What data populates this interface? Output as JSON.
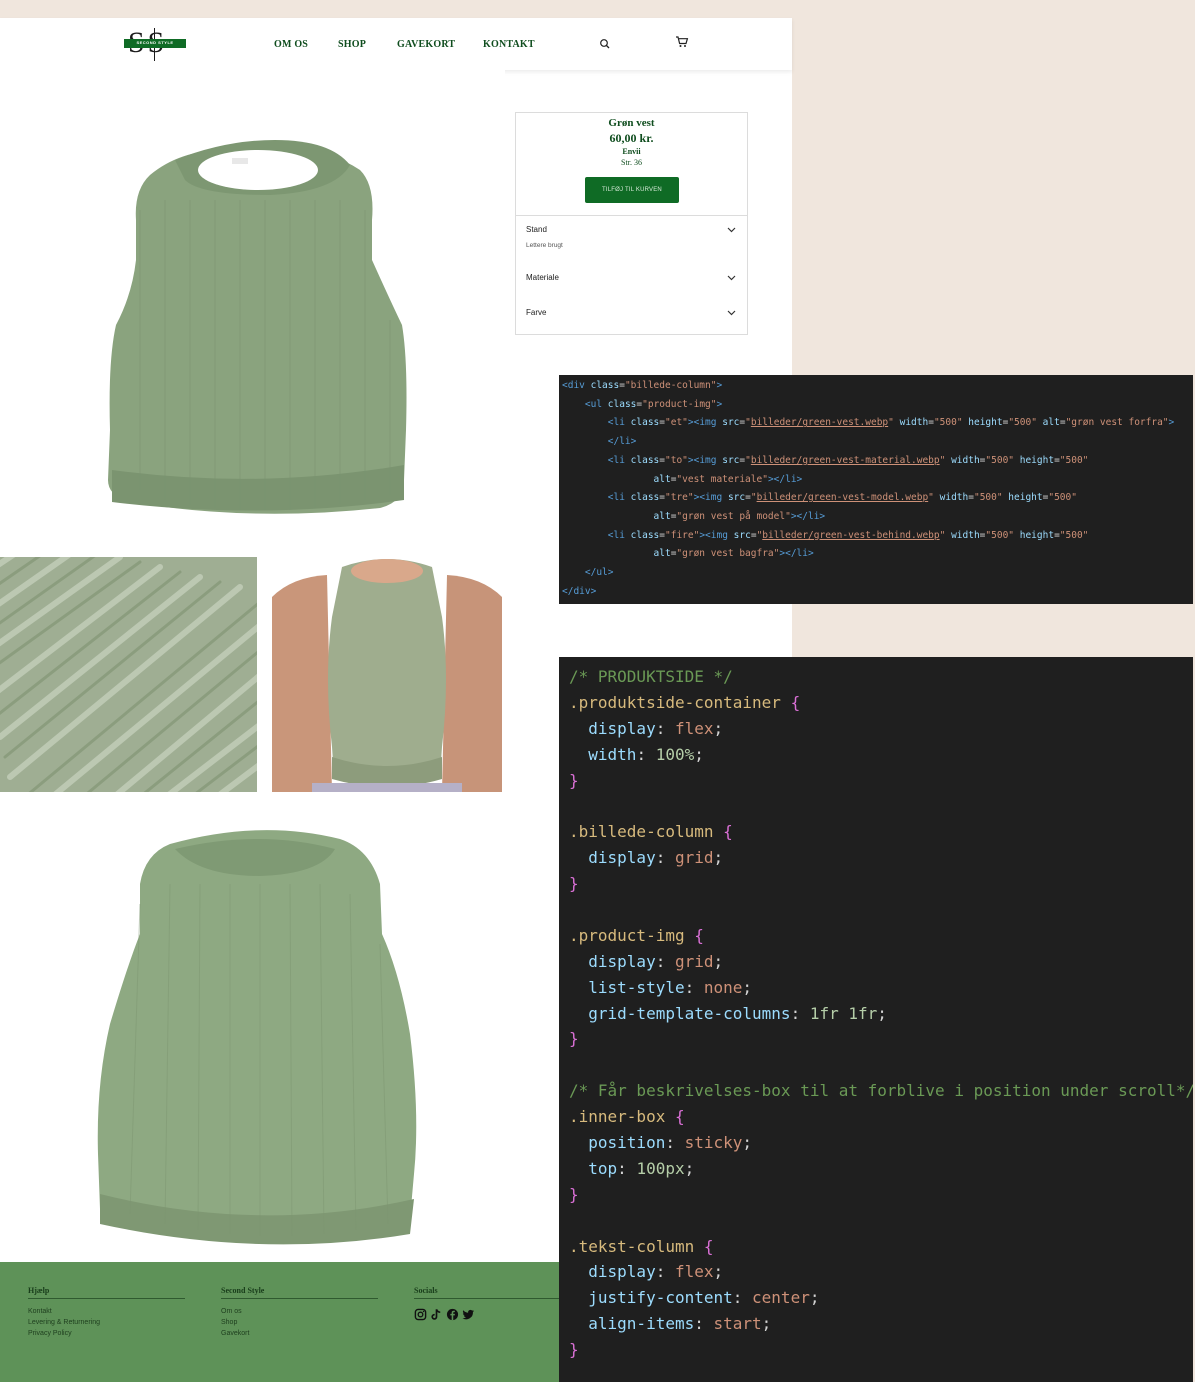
{
  "site": {
    "logo": {
      "monogram": "SS",
      "wordmark": "SECOND STYLE"
    },
    "nav": [
      "OM OS",
      "SHOP",
      "GAVEKORT",
      "KONTAKT"
    ],
    "icons": {
      "search": "search-icon",
      "cart": "cart-icon"
    },
    "product": {
      "title": "Grøn vest",
      "price": "60,00 kr.",
      "brand": "Envii",
      "size": "Str. 36",
      "add_to_cart": "TILFØJ TIL KURVEN",
      "accordions": [
        {
          "label": "Stand",
          "value": "Lettere brugt"
        },
        {
          "label": "Materiale",
          "value": ""
        },
        {
          "label": "Farve",
          "value": ""
        }
      ]
    },
    "footer": {
      "columns": [
        {
          "heading": "Hjælp",
          "links": [
            "Kontakt",
            "Levering & Returnering",
            "Privacy Policy"
          ]
        },
        {
          "heading": "Second Style",
          "links": [
            "Om os",
            "Shop",
            "Gavekort"
          ]
        },
        {
          "heading": "Socials",
          "icons": [
            "instagram-icon",
            "tiktok-icon",
            "facebook-icon",
            "twitter-icon"
          ]
        }
      ]
    },
    "colors": {
      "brand_green": "#0f6b25",
      "footer_green": "#5e9258",
      "background": "#f0e6dd"
    }
  },
  "html_code": [
    [
      [
        "tag",
        "<div "
      ],
      [
        "attr",
        "class"
      ],
      [
        "punct",
        "="
      ],
      [
        "str",
        "\"billede-column\""
      ],
      [
        "tag",
        ">"
      ]
    ],
    [
      [
        "punct",
        "    "
      ],
      [
        "tag",
        "<ul "
      ],
      [
        "attr",
        "class"
      ],
      [
        "punct",
        "="
      ],
      [
        "str",
        "\"product-img\""
      ],
      [
        "tag",
        ">"
      ]
    ],
    [
      [
        "punct",
        "        "
      ],
      [
        "tag",
        "<li "
      ],
      [
        "attr",
        "class"
      ],
      [
        "punct",
        "="
      ],
      [
        "str",
        "\"et\""
      ],
      [
        "tag",
        "><img "
      ],
      [
        "attr",
        "src"
      ],
      [
        "punct",
        "="
      ],
      [
        "str",
        "\""
      ],
      [
        "strlink",
        "billeder/green-vest.webp"
      ],
      [
        "str",
        "\""
      ],
      [
        "attr",
        " width"
      ],
      [
        "punct",
        "="
      ],
      [
        "str",
        "\"500\""
      ],
      [
        "attr",
        " height"
      ],
      [
        "punct",
        "="
      ],
      [
        "str",
        "\"500\""
      ],
      [
        "attr",
        " alt"
      ],
      [
        "punct",
        "="
      ],
      [
        "str",
        "\"grøn vest forfra\""
      ],
      [
        "tag",
        ">"
      ]
    ],
    [
      [
        "punct",
        "        "
      ],
      [
        "tag",
        "</li>"
      ]
    ],
    [
      [
        "punct",
        "        "
      ],
      [
        "tag",
        "<li "
      ],
      [
        "attr",
        "class"
      ],
      [
        "punct",
        "="
      ],
      [
        "str",
        "\"to\""
      ],
      [
        "tag",
        "><img "
      ],
      [
        "attr",
        "src"
      ],
      [
        "punct",
        "="
      ],
      [
        "str",
        "\""
      ],
      [
        "strlink",
        "billeder/green-vest-material.webp"
      ],
      [
        "str",
        "\""
      ],
      [
        "attr",
        " width"
      ],
      [
        "punct",
        "="
      ],
      [
        "str",
        "\"500\""
      ],
      [
        "attr",
        " height"
      ],
      [
        "punct",
        "="
      ],
      [
        "str",
        "\"500\""
      ]
    ],
    [
      [
        "punct",
        "                "
      ],
      [
        "attr",
        "alt"
      ],
      [
        "punct",
        "="
      ],
      [
        "str",
        "\"vest materiale\""
      ],
      [
        "tag",
        "></li>"
      ]
    ],
    [
      [
        "punct",
        "        "
      ],
      [
        "tag",
        "<li "
      ],
      [
        "attr",
        "class"
      ],
      [
        "punct",
        "="
      ],
      [
        "str",
        "\"tre\""
      ],
      [
        "tag",
        "><img "
      ],
      [
        "attr",
        "src"
      ],
      [
        "punct",
        "="
      ],
      [
        "str",
        "\""
      ],
      [
        "strlink",
        "billeder/green-vest-model.webp"
      ],
      [
        "str",
        "\""
      ],
      [
        "attr",
        " width"
      ],
      [
        "punct",
        "="
      ],
      [
        "str",
        "\"500\""
      ],
      [
        "attr",
        " height"
      ],
      [
        "punct",
        "="
      ],
      [
        "str",
        "\"500\""
      ]
    ],
    [
      [
        "punct",
        "                "
      ],
      [
        "attr",
        "alt"
      ],
      [
        "punct",
        "="
      ],
      [
        "str",
        "\"grøn vest på model\""
      ],
      [
        "tag",
        "></li>"
      ]
    ],
    [
      [
        "punct",
        "        "
      ],
      [
        "tag",
        "<li "
      ],
      [
        "attr",
        "class"
      ],
      [
        "punct",
        "="
      ],
      [
        "str",
        "\"fire\""
      ],
      [
        "tag",
        "><img "
      ],
      [
        "attr",
        "src"
      ],
      [
        "punct",
        "="
      ],
      [
        "str",
        "\""
      ],
      [
        "strlink",
        "billeder/green-vest-behind.webp"
      ],
      [
        "str",
        "\""
      ],
      [
        "attr",
        " width"
      ],
      [
        "punct",
        "="
      ],
      [
        "str",
        "\"500\""
      ],
      [
        "attr",
        " height"
      ],
      [
        "punct",
        "="
      ],
      [
        "str",
        "\"500\""
      ]
    ],
    [
      [
        "punct",
        "                "
      ],
      [
        "attr",
        "alt"
      ],
      [
        "punct",
        "="
      ],
      [
        "str",
        "\"grøn vest bagfra\""
      ],
      [
        "tag",
        "></li>"
      ]
    ],
    [
      [
        "punct",
        "    "
      ],
      [
        "tag",
        "</ul>"
      ]
    ],
    [
      [
        "tag",
        "</div>"
      ]
    ]
  ],
  "css_code": [
    [
      [
        "cmt",
        "/* PRODUKTSIDE */"
      ]
    ],
    [
      [
        "sel",
        ".produktside-container "
      ],
      [
        "brace",
        "{"
      ]
    ],
    [
      [
        "punct",
        "  "
      ],
      [
        "prop",
        "display"
      ],
      [
        "punct",
        ": "
      ],
      [
        "val",
        "flex"
      ],
      [
        "punct",
        ";"
      ]
    ],
    [
      [
        "punct",
        "  "
      ],
      [
        "prop",
        "width"
      ],
      [
        "punct",
        ": "
      ],
      [
        "num",
        "100%"
      ],
      [
        "punct",
        ";"
      ]
    ],
    [
      [
        "brace",
        "}"
      ]
    ],
    [],
    [
      [
        "sel",
        ".billede-column "
      ],
      [
        "brace",
        "{"
      ]
    ],
    [
      [
        "punct",
        "  "
      ],
      [
        "prop",
        "display"
      ],
      [
        "punct",
        ": "
      ],
      [
        "val",
        "grid"
      ],
      [
        "punct",
        ";"
      ]
    ],
    [
      [
        "brace",
        "}"
      ]
    ],
    [],
    [
      [
        "sel",
        ".product-img "
      ],
      [
        "brace",
        "{"
      ]
    ],
    [
      [
        "punct",
        "  "
      ],
      [
        "prop",
        "display"
      ],
      [
        "punct",
        ": "
      ],
      [
        "val",
        "grid"
      ],
      [
        "punct",
        ";"
      ]
    ],
    [
      [
        "punct",
        "  "
      ],
      [
        "prop",
        "list-style"
      ],
      [
        "punct",
        ": "
      ],
      [
        "val",
        "none"
      ],
      [
        "punct",
        ";"
      ]
    ],
    [
      [
        "punct",
        "  "
      ],
      [
        "prop",
        "grid-template-columns"
      ],
      [
        "punct",
        ": "
      ],
      [
        "num",
        "1fr 1fr"
      ],
      [
        "punct",
        ";"
      ]
    ],
    [
      [
        "brace",
        "}"
      ]
    ],
    [],
    [
      [
        "cmt",
        "/* Får beskrivelses-box til at forblive i position under scroll*/"
      ]
    ],
    [
      [
        "sel",
        ".inner-box "
      ],
      [
        "brace",
        "{"
      ]
    ],
    [
      [
        "punct",
        "  "
      ],
      [
        "prop",
        "position"
      ],
      [
        "punct",
        ": "
      ],
      [
        "val",
        "sticky"
      ],
      [
        "punct",
        ";"
      ]
    ],
    [
      [
        "punct",
        "  "
      ],
      [
        "prop",
        "top"
      ],
      [
        "punct",
        ": "
      ],
      [
        "num",
        "100px"
      ],
      [
        "punct",
        ";"
      ]
    ],
    [
      [
        "brace",
        "}"
      ]
    ],
    [],
    [
      [
        "sel",
        ".tekst-column "
      ],
      [
        "brace",
        "{"
      ]
    ],
    [
      [
        "punct",
        "  "
      ],
      [
        "prop",
        "display"
      ],
      [
        "punct",
        ": "
      ],
      [
        "val",
        "flex"
      ],
      [
        "punct",
        ";"
      ]
    ],
    [
      [
        "punct",
        "  "
      ],
      [
        "prop",
        "justify-content"
      ],
      [
        "punct",
        ": "
      ],
      [
        "val",
        "center"
      ],
      [
        "punct",
        ";"
      ]
    ],
    [
      [
        "punct",
        "  "
      ],
      [
        "prop",
        "align-items"
      ],
      [
        "punct",
        ": "
      ],
      [
        "val",
        "start"
      ],
      [
        "punct",
        ";"
      ]
    ],
    [
      [
        "brace",
        "}"
      ]
    ]
  ]
}
